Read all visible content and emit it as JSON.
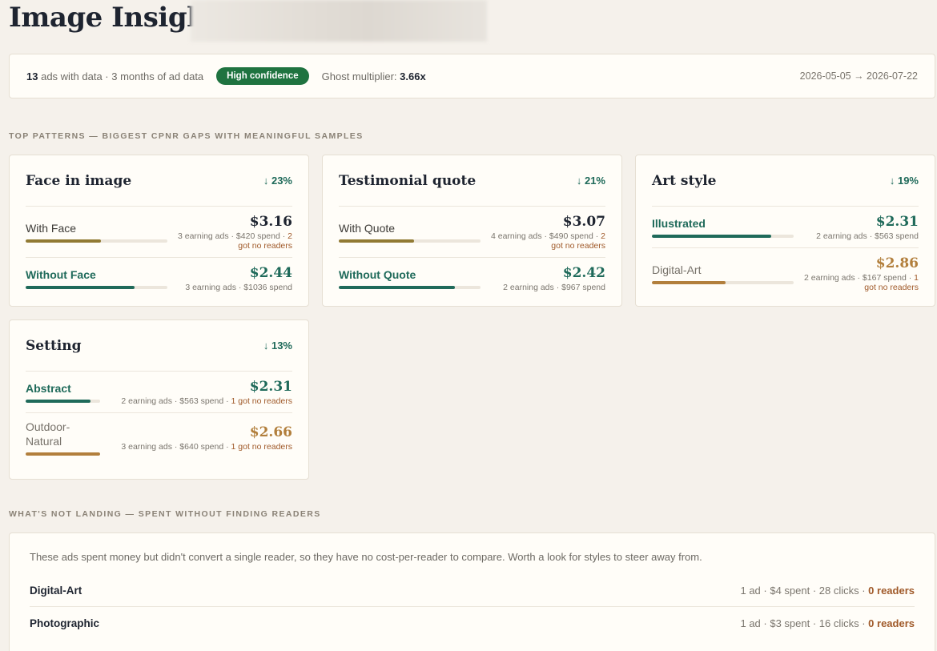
{
  "page": {
    "title": "Image Insights"
  },
  "summary": {
    "ads_count": "13",
    "ads_text": "ads with data · 3 months of ad data",
    "confidence_badge": "High confidence",
    "ghost_label": "Ghost multiplier:",
    "ghost_value": "3.66x",
    "date_range": "2026-05-05 → 2026-07-22"
  },
  "sections": {
    "top_patterns": "Top patterns — biggest CPNR gaps with meaningful samples",
    "not_landing": "What's not landing — spent without finding readers"
  },
  "patterns": [
    {
      "title": "Face in image",
      "delta": "↓ 23%",
      "rows": [
        {
          "label": "With Face",
          "value": "$3.16",
          "meta": "3 earning ads · $420 spend · ",
          "warn": "2 got no readers",
          "fill": 0.53
        },
        {
          "label": "Without Face",
          "value": "$2.44",
          "meta": "3 earning ads · $1036 spend",
          "warn": "",
          "fill": 0.77
        }
      ]
    },
    {
      "title": "Testimonial quote",
      "delta": "↓ 21%",
      "rows": [
        {
          "label": "With Quote",
          "value": "$3.07",
          "meta": "4 earning ads · $490 spend · ",
          "warn": "2 got no readers",
          "fill": 0.53
        },
        {
          "label": "Without Quote",
          "value": "$2.42",
          "meta": "2 earning ads · $967 spend",
          "warn": "",
          "fill": 0.82
        }
      ]
    },
    {
      "title": "Art style",
      "delta": "↓ 19%",
      "rows": [
        {
          "label": "Illustrated",
          "value": "$2.31",
          "meta": "2 earning ads · $563 spend",
          "warn": "",
          "fill": 0.84
        },
        {
          "label": "Digital-Art",
          "value": "$2.86",
          "meta": "2 earning ads · $167 spend · ",
          "warn": "1 got no readers",
          "fill": 0.52
        }
      ]
    },
    {
      "title": "Setting",
      "delta": "↓ 13%",
      "rows": [
        {
          "label": "Abstract",
          "value": "$2.31",
          "meta": "2 earning ads · $563 spend · ",
          "warn": "1 got no readers",
          "fill": 0.87
        },
        {
          "label": "Outdoor-Natural",
          "value": "$2.66",
          "meta": "3 earning ads · $640 spend · ",
          "warn": "1 got no readers",
          "fill": 1.0
        }
      ]
    }
  ],
  "not_landing": {
    "description": "These ads spent money but didn't convert a single reader, so they have no cost-per-reader to compare. Worth a look for styles to steer away from.",
    "items": [
      {
        "name": "Digital-Art",
        "meta": "1 ad · $4 spent · 28 clicks · ",
        "readers": "0 readers"
      },
      {
        "name": "Photographic",
        "meta": "1 ad · $3 spent · 16 clicks · ",
        "readers": "0 readers"
      }
    ]
  },
  "colors": {
    "accent_green": "#1f6a5a",
    "badge_green": "#1f7340",
    "amber": "#b27f3c",
    "olive": "#917a33",
    "warn": "#a05a2a"
  }
}
